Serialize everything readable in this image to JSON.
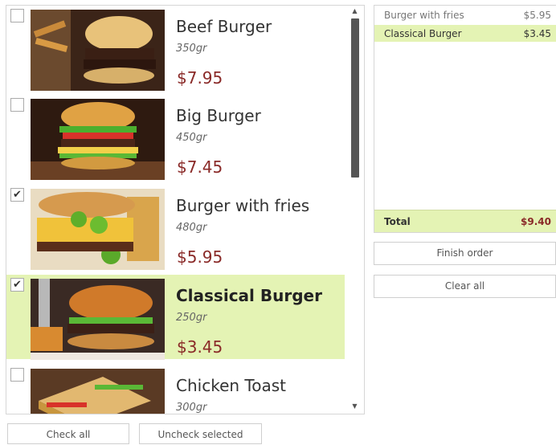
{
  "products": [
    {
      "name": "Beef Burger",
      "weight": "350gr",
      "price": "$7.95",
      "checked": false,
      "selected": false,
      "image": "beef-burger-photo"
    },
    {
      "name": "Big Burger",
      "weight": "450gr",
      "price": "$7.45",
      "checked": false,
      "selected": false,
      "image": "big-burger-photo"
    },
    {
      "name": "Burger with fries",
      "weight": "480gr",
      "price": "$5.95",
      "checked": true,
      "selected": false,
      "image": "burger-with-fries-photo"
    },
    {
      "name": "Classical Burger",
      "weight": "250gr",
      "price": "$3.45",
      "checked": true,
      "selected": true,
      "image": "classical-burger-photo"
    },
    {
      "name": "Chicken Toast",
      "weight": "300gr",
      "price": "",
      "checked": false,
      "selected": false,
      "image": "chicken-toast-photo"
    }
  ],
  "order": {
    "items": [
      {
        "name": "Burger with fries",
        "price": "$5.95",
        "selected": false
      },
      {
        "name": "Classical Burger",
        "price": "$3.45",
        "selected": true
      }
    ],
    "total_label": "Total",
    "total_value": "$9.40"
  },
  "buttons": {
    "finish_order": "Finish order",
    "clear_all": "Clear all",
    "check_all": "Check all",
    "uncheck_selected": "Uncheck selected"
  },
  "checkmark_glyph": "✔",
  "colors": {
    "selection": "#e4f3b4",
    "price": "#8a2a28",
    "border": "#d6d6d6"
  }
}
